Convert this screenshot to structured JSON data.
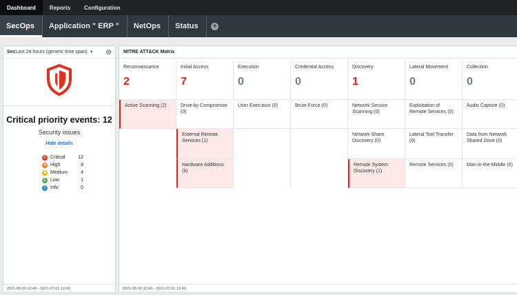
{
  "topnav": [
    "Dashboard",
    "Reports",
    "Configuration"
  ],
  "tabs": [
    "SecOps",
    "Application \" ERP \"",
    "NetOps",
    "Status"
  ],
  "left": {
    "prefix": "Sec",
    "timespan": "Last 24 hours (generic time span)",
    "critical_title": "Critical priority events: 12",
    "issues_title": "Security issues",
    "hide_details": "Hide details",
    "legend": [
      {
        "letter": "C",
        "label": "Critical",
        "count": "12",
        "color": "#e0301e"
      },
      {
        "letter": "H",
        "label": "High",
        "count": "8",
        "color": "#f07d1a"
      },
      {
        "letter": "M",
        "label": "Medium",
        "count": "4",
        "color": "#e6b800"
      },
      {
        "letter": "L",
        "label": "Low",
        "count": "1",
        "color": "#4caf50"
      },
      {
        "letter": "I",
        "label": "Info",
        "count": "0",
        "color": "#2f86d6"
      }
    ],
    "footer": "2021-06-30 12:40 - 2021-07-01 12:40"
  },
  "matrix": {
    "title": "MITRE ATT&CK Matrix",
    "footer": "2021-06-30 12:40 - 2021-07-01 12:40",
    "tactics": [
      {
        "name": "Reconnaissance",
        "count": "2",
        "hit": true
      },
      {
        "name": "Initial Access",
        "count": "7",
        "hit": true
      },
      {
        "name": "Execution",
        "count": "0",
        "hit": false
      },
      {
        "name": "Credential Access",
        "count": "0",
        "hit": false
      },
      {
        "name": "Discovery",
        "count": "1",
        "hit": true
      },
      {
        "name": "Lateral Movement",
        "count": "0",
        "hit": false
      },
      {
        "name": "Collection",
        "count": "0",
        "hit": false
      }
    ],
    "rows": [
      [
        {
          "text": "Active Scanning (2)",
          "hit": true
        },
        {
          "text": "Drive-by Compromise (0)",
          "hit": false
        },
        {
          "text": "User Execution (0)",
          "hit": false
        },
        {
          "text": "Brute Force (0)",
          "hit": false
        },
        {
          "text": "Network Service Scanning (0)",
          "hit": false
        },
        {
          "text": "Exploitation of Remote Services (0)",
          "hit": false
        },
        {
          "text": "Audio Capture (0)",
          "hit": false
        }
      ],
      [
        {
          "text": "",
          "hit": false
        },
        {
          "text": "External Remote Services (1)",
          "hit": true
        },
        {
          "text": "",
          "hit": false
        },
        {
          "text": "",
          "hit": false
        },
        {
          "text": "Network Share Discovery (0)",
          "hit": false
        },
        {
          "text": "Lateral Tool Transfer (0)",
          "hit": false
        },
        {
          "text": "Data from Network Shared Drive (0)",
          "hit": false
        }
      ],
      [
        {
          "text": "",
          "hit": false
        },
        {
          "text": "Hardware Additions (6)",
          "hit": true
        },
        {
          "text": "",
          "hit": false
        },
        {
          "text": "",
          "hit": false
        },
        {
          "text": "Remote System Discovery (1)",
          "hit": true
        },
        {
          "text": "Remote Services (0)",
          "hit": false
        },
        {
          "text": "Man-in-the-Middle (0)",
          "hit": false
        }
      ]
    ]
  },
  "colors": {
    "accent_red": "#d9261c",
    "zero_count": "#6b7d8c",
    "hit_bg": "#fde9e8"
  }
}
